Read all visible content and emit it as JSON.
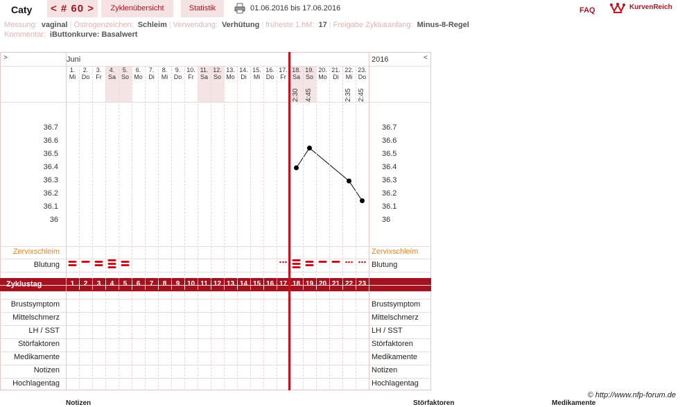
{
  "header": {
    "user_name": "Caty",
    "cycle_nav": "< # 60 >",
    "tab_overview": "Zyklenübersicht",
    "tab_statistics": "Statistik",
    "print_icon": "printer-icon",
    "date_range": "01.06.2016 bis 17.06.2016",
    "faq": "FAQ",
    "logo_icon": "crown-icon",
    "logo_text": "KurvenReich"
  },
  "info_line1": [
    {
      "label": "Messung:",
      "value": "vaginal"
    },
    {
      "label": "Östrogenzeichen:",
      "value": "Schleim"
    },
    {
      "label": "Verwendung:",
      "value": "Verhütung"
    },
    {
      "label": "früheste 1.hM:",
      "value": "17"
    },
    {
      "label": "Freigabe Zyklusanfang:",
      "value": "Minus-8-Regel"
    }
  ],
  "info_line2": {
    "label": "Kommentar:",
    "value": "iButtonkurve: Basalwert"
  },
  "grid": {
    "nav_prev": ">",
    "nav_next": "<",
    "month": "Juni",
    "year": "2016",
    "days": [
      {
        "num": "1.",
        "wd": "Mi",
        "weekend": false
      },
      {
        "num": "2.",
        "wd": "Do",
        "weekend": false
      },
      {
        "num": "3.",
        "wd": "Fr",
        "weekend": false
      },
      {
        "num": "4.",
        "wd": "Sa",
        "weekend": true
      },
      {
        "num": "5.",
        "wd": "So",
        "weekend": true
      },
      {
        "num": "6.",
        "wd": "Mo",
        "weekend": false
      },
      {
        "num": "7.",
        "wd": "Di",
        "weekend": false
      },
      {
        "num": "8.",
        "wd": "Mi",
        "weekend": false
      },
      {
        "num": "9.",
        "wd": "Do",
        "weekend": false
      },
      {
        "num": "10.",
        "wd": "Fr",
        "weekend": false
      },
      {
        "num": "11.",
        "wd": "Sa",
        "weekend": true
      },
      {
        "num": "12.",
        "wd": "So",
        "weekend": true
      },
      {
        "num": "13.",
        "wd": "Mo",
        "weekend": false
      },
      {
        "num": "14.",
        "wd": "Di",
        "weekend": false
      },
      {
        "num": "15.",
        "wd": "Mi",
        "weekend": false
      },
      {
        "num": "16.",
        "wd": "Do",
        "weekend": false
      },
      {
        "num": "17.",
        "wd": "Fr",
        "weekend": false
      },
      {
        "num": "18.",
        "wd": "Sa",
        "weekend": true
      },
      {
        "num": "19.",
        "wd": "So",
        "weekend": true
      },
      {
        "num": "20.",
        "wd": "Mo",
        "weekend": false
      },
      {
        "num": "21.",
        "wd": "Di",
        "weekend": false
      },
      {
        "num": "22.",
        "wd": "Mi",
        "weekend": false
      },
      {
        "num": "23.",
        "wd": "Do",
        "weekend": false
      }
    ],
    "times": [
      "",
      "",
      "",
      "",
      "",
      "",
      "",
      "",
      "",
      "",
      "",
      "",
      "",
      "",
      "",
      "",
      "",
      "2:30",
      "4:45",
      "",
      "",
      "2:35",
      "2:45"
    ],
    "temp_ticks": [
      "36.7",
      "36.6",
      "36.5",
      "36.4",
      "36.3",
      "36.2",
      "36.1",
      "36"
    ],
    "bleeding": [
      "medium",
      "light",
      "medium",
      "heavy",
      "medium",
      "",
      "",
      "",
      "",
      "",
      "",
      "",
      "",
      "",
      "",
      "",
      "spotting",
      "heavy",
      "medium",
      "light",
      "light",
      "spotting",
      "spotting"
    ],
    "row_labels": {
      "cervical": "Zervixschleim",
      "bleeding": "Blutung",
      "cycle_day": "Zyklustag",
      "breast": "Brustsymptom",
      "midpain": "Mittelschmerz",
      "lh": "LH / SST",
      "disturb": "Störfaktoren",
      "meds": "Medikamente",
      "notes": "Notizen",
      "high": "Hochlagentag"
    },
    "cycle_days": [
      "1",
      "2",
      "3",
      "4",
      "5",
      "6",
      "7",
      "8",
      "9",
      "10",
      "11",
      "12",
      "13",
      "14",
      "15",
      "16",
      "17",
      "18",
      "19",
      "20",
      "21",
      "22",
      "23"
    ]
  },
  "chart_data": {
    "type": "line",
    "x": [
      18,
      19,
      22,
      23
    ],
    "values": [
      36.4,
      36.55,
      36.3,
      36.15
    ],
    "ylim": [
      36.0,
      36.7
    ],
    "ticks": [
      36.7,
      36.6,
      36.5,
      36.4,
      36.3,
      36.2,
      36.1,
      36.0
    ],
    "color": "#000000"
  },
  "colors": {
    "accent": "#a4111f",
    "tab_bg": "#f5e3e3",
    "label_pink": "#e1b4b4",
    "orange": "#e0882a"
  },
  "footer": {
    "copyright": "© http://www.nfp-forum.de",
    "bottom_headings": [
      "Notizen",
      "Störfaktoren",
      "Medikamente"
    ]
  }
}
